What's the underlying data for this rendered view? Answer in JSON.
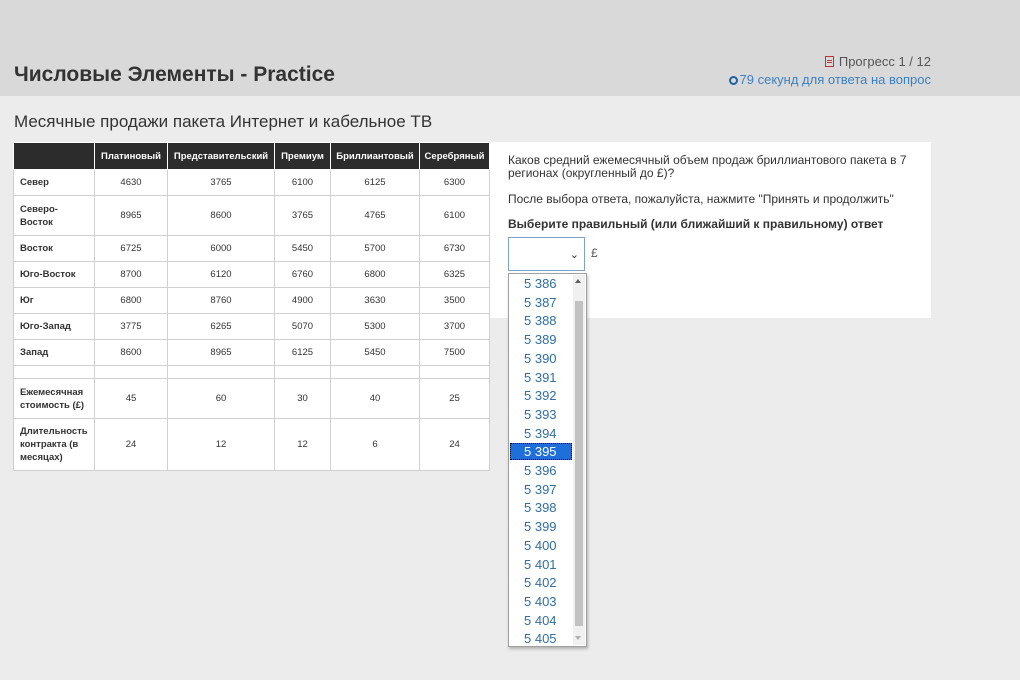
{
  "header": {
    "title": "Числовые Элементы - Practice",
    "progress": "Прогресс 1 / 12",
    "timer": "79 секунд для ответа на вопрос"
  },
  "subtitle": "Месячные продажи пакета Интернет и кабельное ТВ",
  "table": {
    "columns": [
      "Платиновый",
      "Представительский",
      "Премиум",
      "Бриллиантовый",
      "Серебряный"
    ],
    "rows": [
      {
        "label": "Север",
        "values": [
          "4630",
          "3765",
          "6100",
          "6125",
          "6300"
        ]
      },
      {
        "label": "Северо-Восток",
        "values": [
          "8965",
          "8600",
          "3765",
          "4765",
          "6100"
        ]
      },
      {
        "label": "Восток",
        "values": [
          "6725",
          "6000",
          "5450",
          "5700",
          "6730"
        ]
      },
      {
        "label": "Юго-Восток",
        "values": [
          "8700",
          "6120",
          "6760",
          "6800",
          "6325"
        ]
      },
      {
        "label": "Юг",
        "values": [
          "6800",
          "8760",
          "4900",
          "3630",
          "3500"
        ]
      },
      {
        "label": "Юго-Запад",
        "values": [
          "3775",
          "6265",
          "5070",
          "5300",
          "3700"
        ]
      },
      {
        "label": "Запад",
        "values": [
          "8600",
          "8965",
          "6125",
          "5450",
          "7500"
        ]
      }
    ],
    "extra_rows": [
      {
        "label": "Ежемесячная стоимость (£)",
        "values": [
          "45",
          "60",
          "30",
          "40",
          "25"
        ]
      },
      {
        "label": "Длительность контракта (в месяцах)",
        "values": [
          "24",
          "12",
          "12",
          "6",
          "24"
        ]
      }
    ]
  },
  "question": {
    "text": "Каков средний ежемесячный объем продаж бриллиантового пакета в 7 регионах (округленный до £)?",
    "instruction": "После выбора ответа, пожалуйста, нажмите \"Принять и продолжить\"",
    "prompt": "Выберите правильный (или ближайший к правильному) ответ",
    "select_value": "",
    "currency": "£"
  },
  "dropdown": {
    "options": [
      "5 386",
      "5 387",
      "5 388",
      "5 389",
      "5 390",
      "5 391",
      "5 392",
      "5 393",
      "5 394",
      "5 395",
      "5 396",
      "5 397",
      "5 398",
      "5 399",
      "5 400",
      "5 401",
      "5 402",
      "5 403",
      "5 404",
      "5 405"
    ],
    "highlighted": "5 395"
  }
}
